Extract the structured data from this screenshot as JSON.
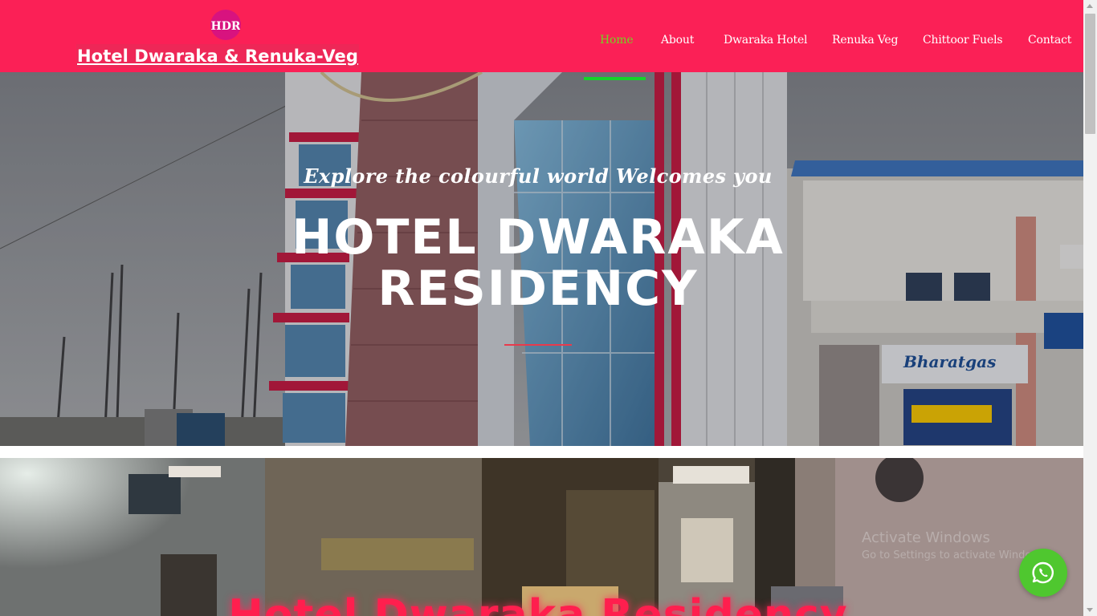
{
  "header": {
    "logo_monogram": "HDR",
    "site_title": "Hotel Dwaraka & Renuka-Veg",
    "nav": [
      {
        "label": "Home",
        "active": true
      },
      {
        "label": "About",
        "active": false
      },
      {
        "label": "Dwaraka Hotel",
        "active": false
      },
      {
        "label": "Renuka Veg",
        "active": false
      },
      {
        "label": "Chittoor Fuels",
        "active": false
      },
      {
        "label": "Contact",
        "active": false
      }
    ]
  },
  "hero": {
    "kicker": "Explore the colourful world Welcomes you",
    "title_line1": "HOTEL DWARAKA",
    "title_line2": "RESIDENCY"
  },
  "second_section": {
    "title": "Hotel Dwaraka Residency"
  },
  "os_watermark": {
    "line1": "Activate Windows",
    "line2": "Go to Settings to activate Windows."
  },
  "colors": {
    "header_bg": "#fb2056",
    "nav_active": "#76d123",
    "nav_indicator": "#15d32a",
    "accent_red": "#e83a4c",
    "whatsapp_green": "#4fc72f"
  },
  "icons": {
    "logo": "hdr-logo-icon",
    "chat": "whatsapp-icon"
  }
}
